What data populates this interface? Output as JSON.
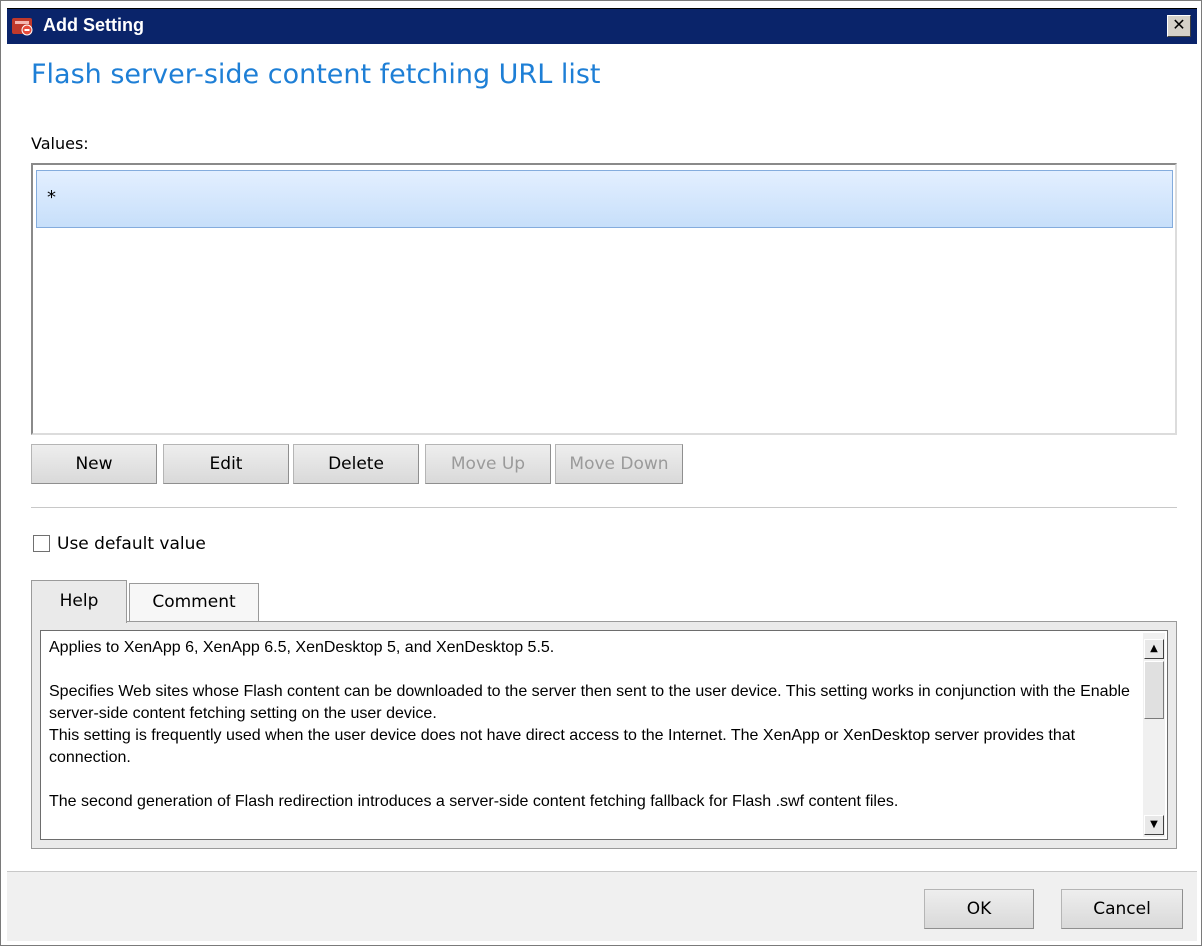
{
  "window": {
    "title": "Add Setting",
    "close_symbol": "✕"
  },
  "heading": "Flash server-side content fetching URL list",
  "values": {
    "label": "Values:",
    "items": [
      "*"
    ]
  },
  "list_buttons": {
    "new": "New",
    "edit": "Edit",
    "delete": "Delete",
    "move_up": "Move Up",
    "move_down": "Move Down"
  },
  "use_default": {
    "label": "Use default value",
    "checked": false
  },
  "tabs": [
    {
      "label": "Help",
      "active": true
    },
    {
      "label": "Comment",
      "active": false
    }
  ],
  "help": {
    "paragraphs": [
      "Applies to XenApp 6, XenApp 6.5, XenDesktop 5, and XenDesktop 5.5.",
      "Specifies Web sites whose Flash content can be downloaded to the server then sent to the user device. This setting works in conjunction with the Enable server-side content fetching setting on the user device.\nThis setting is frequently used when the user device does not have direct access to the Internet. The XenApp or XenDesktop server provides that connection.",
      "The second generation of Flash redirection introduces a server-side content fetching fallback for Flash .swf content files."
    ]
  },
  "footer": {
    "ok": "OK",
    "cancel": "Cancel"
  },
  "colors": {
    "title_bar": "#0a246a",
    "heading": "#1e7fd6",
    "selected_row": "#c7dffa"
  },
  "icons": {
    "app_icon": "citrix-policy-icon",
    "close": "close-icon"
  }
}
